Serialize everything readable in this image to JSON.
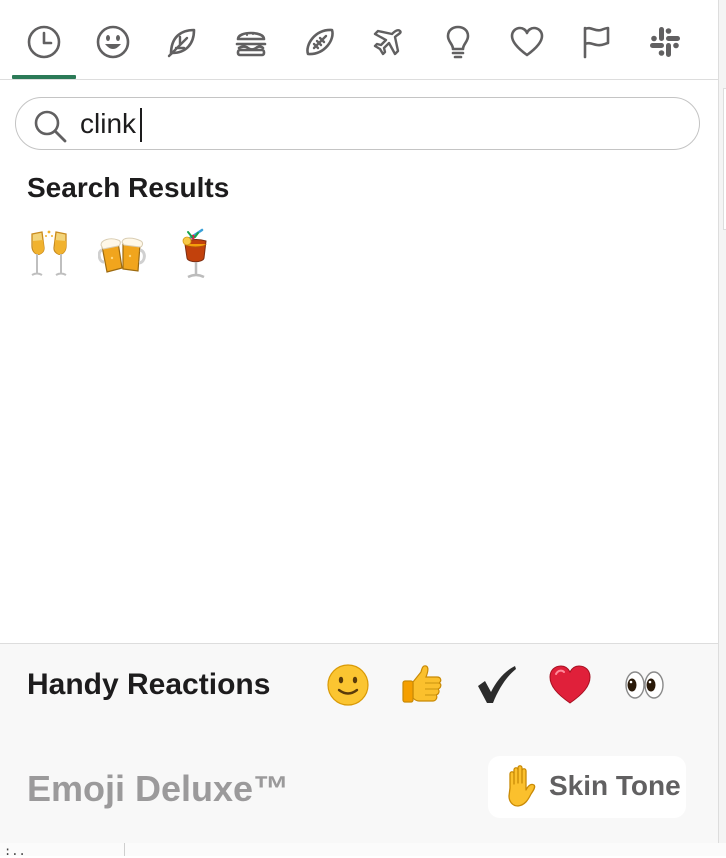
{
  "tabs": [
    {
      "name": "recent",
      "icon": "clock-icon"
    },
    {
      "name": "smileys",
      "icon": "smiley-icon"
    },
    {
      "name": "nature",
      "icon": "leaf-icon"
    },
    {
      "name": "food",
      "icon": "burger-icon"
    },
    {
      "name": "activity",
      "icon": "football-icon"
    },
    {
      "name": "travel",
      "icon": "airplane-icon"
    },
    {
      "name": "objects",
      "icon": "lightbulb-icon"
    },
    {
      "name": "symbols",
      "icon": "heart-icon"
    },
    {
      "name": "flags",
      "icon": "flag-icon"
    },
    {
      "name": "custom",
      "icon": "slack-logo-icon"
    }
  ],
  "active_tab": "recent",
  "colors": {
    "accent": "#2b7a57",
    "border": "#dddddd",
    "muted": "#9b9a9b"
  },
  "search": {
    "value": "clink",
    "placeholder": ""
  },
  "results_section": {
    "title": "Search Results",
    "items": [
      "clinking-glasses-icon",
      "clinking-beer-mugs-icon",
      "tropical-drink-icon"
    ]
  },
  "handy": {
    "label": "Handy Reactions",
    "items": [
      "slightly-smiling-face-icon",
      "thumbs-up-icon",
      "heavy-check-mark-icon",
      "red-heart-icon",
      "eyes-icon"
    ]
  },
  "footer": {
    "title": "Emoji Deluxe™",
    "skin_tone_label": "Skin Tone",
    "skin_tone_icon": "raised-hand-icon"
  }
}
